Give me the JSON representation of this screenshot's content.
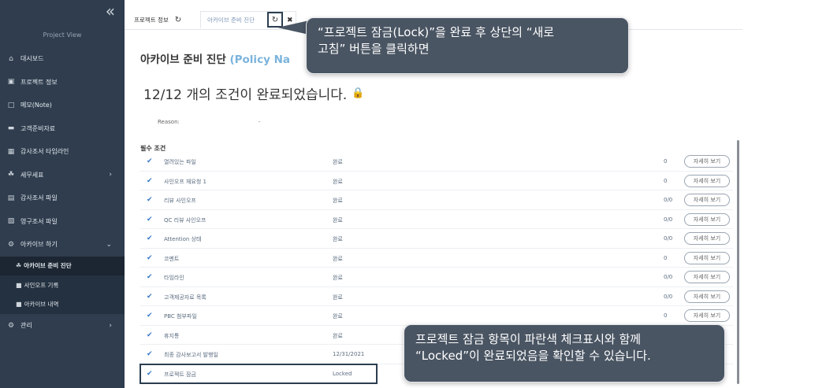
{
  "sidebar": {
    "project_view": "Project View",
    "items": [
      {
        "icon": "home-icon",
        "glyph": "⌂",
        "label": "대시보드"
      },
      {
        "icon": "info-icon",
        "glyph": "▣",
        "label": "프로젝트 정보"
      },
      {
        "icon": "note-icon",
        "glyph": "□",
        "label": "메모(Note)"
      },
      {
        "icon": "client-docs-icon",
        "glyph": "▬",
        "label": "고객준비자료"
      },
      {
        "icon": "calendar-icon",
        "glyph": "▦",
        "label": "감사조서 타임라인"
      },
      {
        "icon": "tax-icon",
        "glyph": "☘",
        "label": "세무세표",
        "arrow": "›"
      },
      {
        "icon": "workpaper-icon",
        "glyph": "▤",
        "label": "감사조서 파일"
      },
      {
        "icon": "permanent-file-icon",
        "glyph": "▧",
        "label": "영구조서 파일"
      },
      {
        "icon": "archive-icon",
        "glyph": "⚙",
        "label": "아카이브 하기",
        "arrow": "⌄"
      }
    ],
    "sub_items": [
      {
        "icon": "diagnosis-icon",
        "glyph": "☘",
        "label": "아카이브 준비 진단",
        "active": true
      },
      {
        "icon": "signoff-icon",
        "glyph": "■",
        "label": "사인오프 기록"
      },
      {
        "icon": "archive-history-icon",
        "glyph": "■",
        "label": "아카이브 내역"
      }
    ],
    "admin": {
      "icon": "gear-icon",
      "glyph": "⚙",
      "label": "관리",
      "arrow": "›"
    }
  },
  "tabs": {
    "tab1_label": "프로젝트 정보",
    "tab2_label": "아카이브 준비 진단",
    "refresh_glyph": "↻",
    "close_glyph": "✖"
  },
  "main": {
    "title": "아카이브 준비 진단",
    "title_policy": "(Policy Na",
    "status_text": "12/12 개의 조건이 완료되었습니다.",
    "lock_glyph": "🔒",
    "reason_label": "Reason:",
    "reason_value": "-",
    "required_title": "필수 조건",
    "check_glyph": "✔",
    "rows": [
      {
        "name": "열려있는 파일",
        "status": "완료",
        "count": "0",
        "detail": "자세히 보기"
      },
      {
        "name": "사인오프 재요청 1",
        "status": "완료",
        "count": "0",
        "detail": "자세히 보기"
      },
      {
        "name": "리뷰 사인오프",
        "status": "완료",
        "count": "0/0",
        "detail": "자세히 보기"
      },
      {
        "name": "QC 리뷰 사인오프",
        "status": "완료",
        "count": "0/0",
        "detail": "자세히 보기"
      },
      {
        "name": "Attention 상태",
        "status": "완료",
        "count": "0/0",
        "detail": "자세히 보기"
      },
      {
        "name": "코멘트",
        "status": "완료",
        "count": "0",
        "detail": "자세히 보기"
      },
      {
        "name": "타임라인",
        "status": "완료",
        "count": "0/0",
        "detail": "자세히 보기"
      },
      {
        "name": "고객제공자료 목록",
        "status": "완료",
        "count": "0/0",
        "detail": "자세히 보기"
      },
      {
        "name": "PBC 첨부파일",
        "status": "완료",
        "count": "0",
        "detail": "자세히 보기"
      },
      {
        "name": "휴지통",
        "status": "완료",
        "count": "",
        "detail": ""
      },
      {
        "name": "최종 감사보고서 발행일",
        "status": "12/31/2021",
        "count": "",
        "detail": ""
      },
      {
        "name": "프로젝트 잠금",
        "status": "Locked",
        "count": "",
        "detail": ""
      }
    ]
  },
  "callouts": {
    "top": "“프로젝트 잠금(Lock)”을 완료 후 상단의 “새로\n고침” 버튼을 클릭하면",
    "bottom": "프로젝트 잠금 항목이 파란색 체크표시와 함께\n“Locked”이 완료되었음을 확인할 수 있습니다."
  },
  "colors": {
    "sidebar_bg": "#2f3d4e",
    "accent_blue": "#3778c7",
    "policy_blue": "#7ab3dc",
    "lock_orange": "#f3a51d",
    "callout_bg": "#4a5563"
  }
}
